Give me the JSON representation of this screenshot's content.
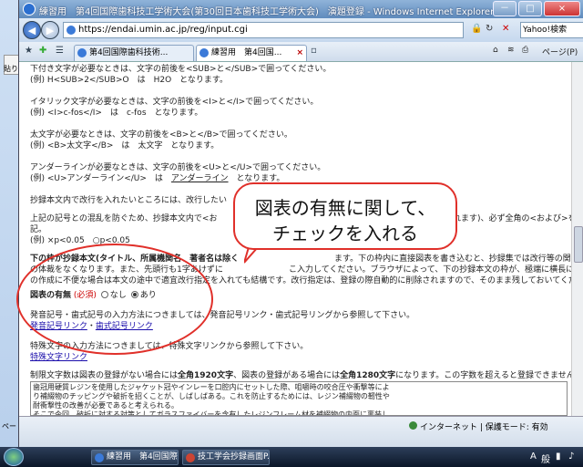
{
  "window": {
    "title": "練習用　第4回国際歯科技工学術大会(第30回日本歯科技工学術大会)　演題登録 - Windows Internet Explorer",
    "controls": [
      "－",
      "□",
      "×"
    ]
  },
  "address_bar": {
    "url": "https://endai.umin.ac.jp/reg/input.cgi",
    "search_placeholder": "Yahoo!検索"
  },
  "tabs": [
    {
      "label": "第4回国際歯科技術..."
    },
    {
      "label": "練習用　第4回国..."
    }
  ],
  "command_bar": {
    "page_label": "ページ(P)"
  },
  "background_app": {
    "paste_label": "貼り",
    "page_label": "ペー"
  },
  "content": {
    "line_sub_intro": "下付き文字が必要なときは、文字の前後を<SUB>と</SUB>で囲ってください。",
    "line_sub_example": "(例) H<SUB>2</SUB>O　は　H2O　となります。",
    "line_italic_intro": "イタリック文字が必要なときは、文字の前後を<I>と</I>で囲ってください。",
    "line_italic_example": "(例) <I>c-fos</I>　は　c-fos　となります。",
    "line_bold_intro": "太文字が必要なときは、文字の前後を<B>と</B>で囲ってください。",
    "line_bold_example": "(例) <B>太文字</B>　は　太文字　となります。",
    "line_underline_intro": "アンダーラインが必要なときは、文字の前後を<U>と</U>で囲ってください。",
    "line_underline_example_prefix": "(例) <U>アンダーライン</U>　は　",
    "line_underline_example_word": "アンダーライン",
    "line_underline_example_suffix": "　となります。",
    "line_newline": "抄録本文内で改行を入れたいところには、改行したい",
    "line_symbols": "上記の記号との混乱を防ぐため、抄録本文内で<お",
    "line_symbols_tail": "れます)、必ず全角の<および>を(",
    "line_symbols_2": "記。",
    "line_p_example": "(例) ×p<0.05　○p<0.05",
    "line_abstract_1": "下の枠が抄録本文(タイトル、所属機関名、著者名は除く",
    "line_abstract_1_tail": "ます。下の枠内に直接図表を書き込むと、抄録集では改行等の関係でずれて",
    "line_abstract_2": "の体裁をなくなります。また、先頭行も1字あけずに",
    "line_abstract_2_tail": "こ入力してください。ブラウザによって、下の抄録本文の枠が、極端に横長になってしまい",
    "line_abstract_3": "の作成に不便な場合は本文の途中で適宜改行指定を入れても結構です。改行指定は、登録の際自動的に削除されますので、そのまま残しておいてくださ",
    "figure_label": "図表の有無",
    "required_label": "(必須)",
    "radio_none": "なし",
    "radio_yes": "あり",
    "line_symbol_input": "発音記号・歯式記号の入力方法につきましては、発音記号リンク・歯式記号リングから参照して下さい。",
    "link_phonetic": "発音記号リンク",
    "link_separator": "・",
    "link_tooth": "歯式記号リンク",
    "line_special_char": "特殊文字の入力方法につきましては、特殊文字リンクから参照して下さい。",
    "link_special": "特殊文字リンク",
    "line_limit_prefix": "制限文字数は図表の登録がない場合には",
    "line_limit_1920": "全角1920文字",
    "line_limit_mid": "、図表の登録がある場合には",
    "line_limit_1280": "全角1280文字",
    "line_limit_suffix": "になります。この字数を超えると登録できません。",
    "textarea_text": "歯冠用硬質レジンを使用したジャケット冠やインレーを口腔内にセットした際、咀嚼時の咬合圧や衝撃等によ\nり補綴物のチッピングや破折を招くことが、しばしばある。これを防止するためには、レジン補綴物の靭性や\n耐衝撃性の改善が必要であると考えられる。\nそこで今回、破折に対する対策としてガラスファイバーを含有したレジンフレーム材を補綴物の内面に裏装し、"
  },
  "callout": {
    "line1": "図表の有無に関して、",
    "line2": "チェックを入れる"
  },
  "status_bar": {
    "zone": "インターネット | 保護モード: 有効"
  },
  "taskbar": {
    "buttons": [
      {
        "label": "練習用　第4回国際..."
      },
      {
        "label": "技工学会抄録画面P..."
      }
    ],
    "tray": [
      "A",
      "般"
    ]
  }
}
